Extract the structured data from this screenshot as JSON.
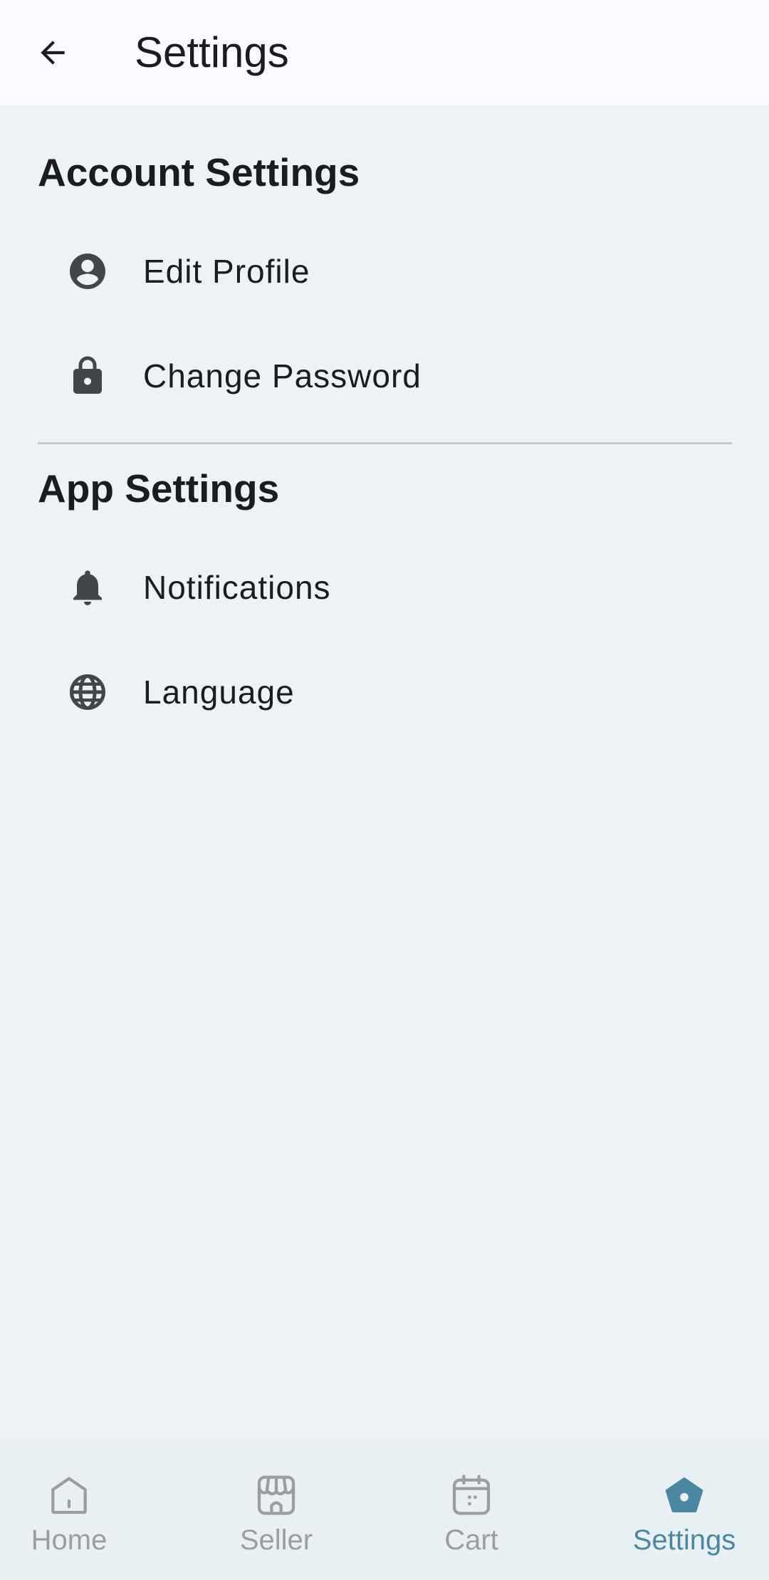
{
  "app_bar": {
    "title": "Settings",
    "back_icon": "arrow-back-icon"
  },
  "sections": [
    {
      "title": "Account Settings",
      "items": [
        {
          "label": "Edit Profile",
          "icon": "account-circle-icon"
        },
        {
          "label": "Change Password",
          "icon": "lock-icon"
        }
      ]
    },
    {
      "title": "App Settings",
      "items": [
        {
          "label": "Notifications",
          "icon": "bell-icon"
        },
        {
          "label": "Language",
          "icon": "globe-icon"
        }
      ]
    }
  ],
  "bottom_nav": {
    "items": [
      {
        "label": "Home",
        "icon": "home-icon",
        "active": false
      },
      {
        "label": "Seller",
        "icon": "storefront-icon",
        "active": false
      },
      {
        "label": "Cart",
        "icon": "calendar-icon",
        "active": false
      },
      {
        "label": "Settings",
        "icon": "settings-pentagon-icon",
        "active": true
      }
    ]
  },
  "colors": {
    "background": "#eef1f5",
    "app_bar": "#f9fafd",
    "nav_bar": "#e9f0f3",
    "icon": "#41464b",
    "nav_inactive": "#9a9ea3",
    "nav_active": "#4a88a0",
    "divider": "#c4c7cc"
  }
}
